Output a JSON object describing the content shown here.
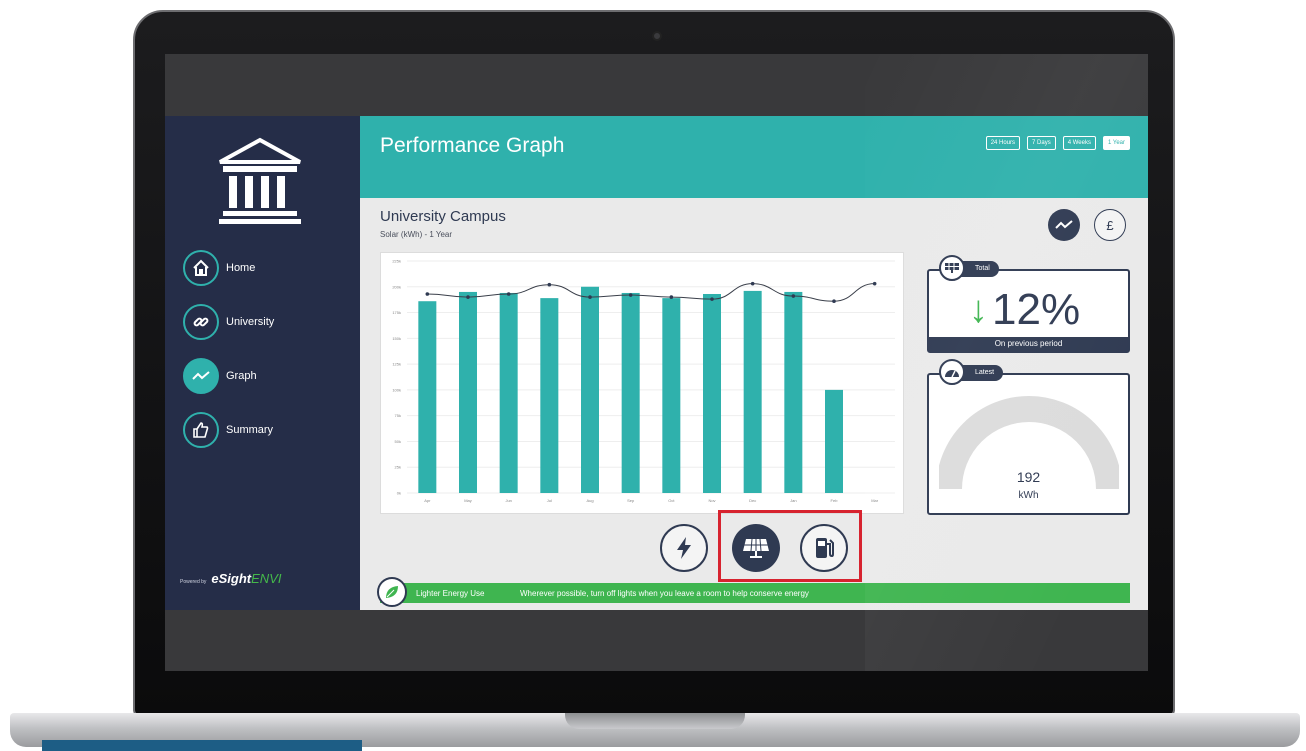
{
  "app": {
    "sidebar": {
      "logo_icon": "university-building-icon",
      "items": [
        {
          "label": "Home",
          "icon": "house-icon"
        },
        {
          "label": "University",
          "icon": "link-icon"
        },
        {
          "label": "Graph",
          "icon": "line-graph-icon",
          "active": true
        },
        {
          "label": "Summary",
          "icon": "thumbs-up-icon"
        }
      ],
      "powered_prefix": "Powered by",
      "powered_brand": "eSight",
      "powered_brand_suffix": "ENVI"
    },
    "header": {
      "title": "Performance Graph",
      "ranges": [
        {
          "label": "24 Hours"
        },
        {
          "label": "7 Days"
        },
        {
          "label": "4 Weeks"
        },
        {
          "label": "1 Year",
          "active": true
        }
      ]
    },
    "campus": {
      "title": "University Campus",
      "subtitle": "Solar (kWh) - 1 Year"
    },
    "view_toggle": {
      "graph_icon": "line-graph-icon",
      "money_symbol": "£"
    },
    "total_card": {
      "tag": "Total",
      "icon": "solar-panel-icon",
      "arrow": "↓",
      "value": "12%",
      "footer": "On previous period"
    },
    "latest_card": {
      "tag": "Latest",
      "icon": "speedometer-icon",
      "value": "192",
      "unit": "kWh"
    },
    "energy_types": [
      {
        "name": "electricity",
        "icon": "lightning-icon"
      },
      {
        "name": "solar",
        "icon": "solar-panel-icon",
        "active": true
      },
      {
        "name": "fuel",
        "icon": "fuel-pump-icon"
      }
    ],
    "tip": {
      "icon": "leaf-icon",
      "title": "Lighter Energy Use",
      "text": "Wherever possible, turn off lights when you leave a room to help conserve energy"
    },
    "colors": {
      "teal": "#2fb1ac",
      "navy": "#2f3a52",
      "sidebar": "#252d48",
      "green": "#3fb550",
      "highlight": "#d7232f"
    }
  },
  "chart_data": {
    "type": "bar",
    "categories": [
      "Apr",
      "May",
      "Jun",
      "Jul",
      "Aug",
      "Sep",
      "Oct",
      "Nov",
      "Dec",
      "Jan",
      "Feb",
      "Mar"
    ],
    "y_ticks": [
      "0k",
      "25k",
      "50k",
      "75k",
      "100k",
      "125k",
      "150k",
      "175k",
      "200k",
      "225k"
    ],
    "ylim": [
      0,
      225
    ],
    "series": [
      {
        "values": [
          186,
          195,
          194,
          189,
          200,
          194,
          189,
          193,
          196,
          195,
          100,
          null
        ]
      },
      {
        "values": [
          193,
          190,
          193,
          202,
          190,
          192,
          190,
          188,
          203,
          191,
          186,
          203
        ]
      }
    ]
  }
}
